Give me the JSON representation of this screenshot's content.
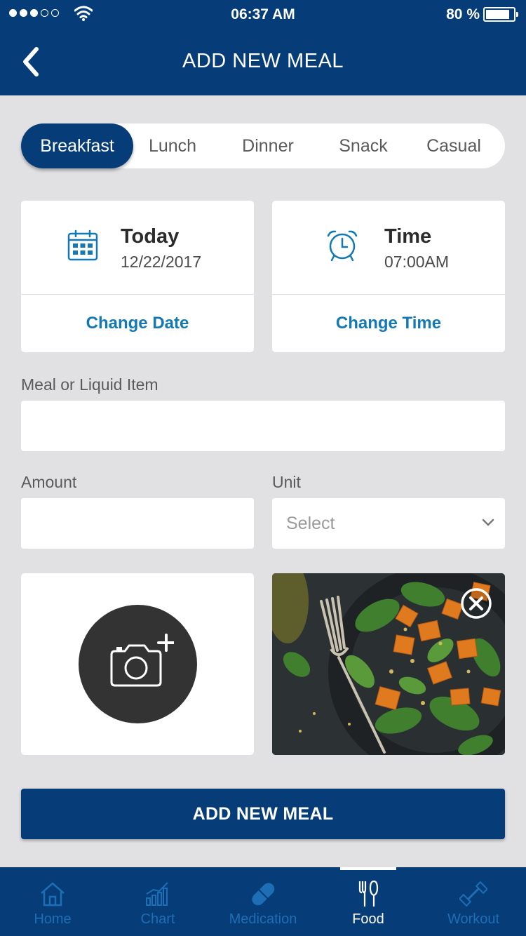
{
  "status_bar": {
    "time": "06:37 AM",
    "battery": "80 %"
  },
  "header": {
    "title": "ADD NEW MEAL",
    "back_icon": "chevron-left-icon"
  },
  "meal_types": {
    "selected": "Breakfast",
    "items": [
      "Breakfast",
      "Lunch",
      "Dinner",
      "Snack",
      "Casual"
    ]
  },
  "date_card": {
    "label": "Today",
    "value": "12/22/2017",
    "action": "Change Date",
    "icon": "calendar-icon"
  },
  "time_card": {
    "label": "Time",
    "value": "07:00AM",
    "action": "Change Time",
    "icon": "alarm-clock-icon"
  },
  "form": {
    "item_label": "Meal or Liquid Item",
    "item_value": "",
    "amount_label": "Amount",
    "amount_value": "",
    "unit_label": "Unit",
    "unit_selected": "Select"
  },
  "photo": {
    "add_icon": "camera-add-icon",
    "remove_icon": "close-circle-icon"
  },
  "submit_label": "ADD NEW MEAL",
  "tabs": [
    {
      "label": "Home",
      "icon": "home-icon",
      "active": false
    },
    {
      "label": "Chart",
      "icon": "bar-chart-icon",
      "active": false
    },
    {
      "label": "Medication",
      "icon": "pill-icon",
      "active": false
    },
    {
      "label": "Food",
      "icon": "fork-knife-icon",
      "active": true
    },
    {
      "label": "Workout",
      "icon": "dumbbell-icon",
      "active": false
    }
  ],
  "colors": {
    "primary": "#063d78",
    "accent": "#1279b5",
    "background": "#e1e1e3"
  }
}
